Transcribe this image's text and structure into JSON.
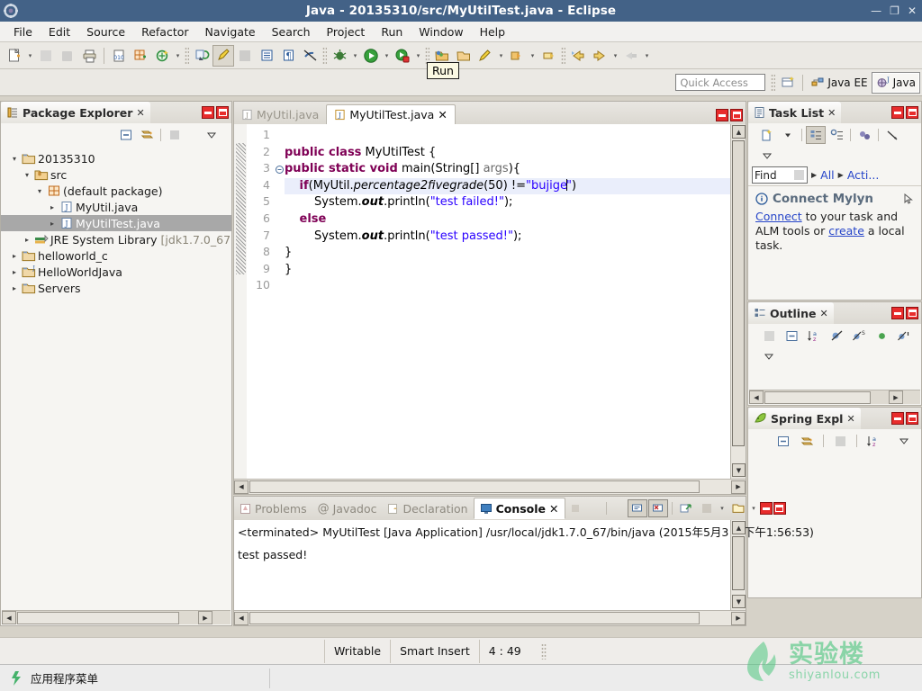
{
  "window": {
    "title": "Java - 20135310/src/MyUtilTest.java - Eclipse",
    "minimize": "—",
    "restore": "❐",
    "close": "✕",
    "app_icon": "eclipse-icon",
    "titlebar_color": "#436287"
  },
  "menu": {
    "items": [
      {
        "label": "File"
      },
      {
        "label": "Edit"
      },
      {
        "label": "Source"
      },
      {
        "label": "Refactor"
      },
      {
        "label": "Navigate"
      },
      {
        "label": "Search"
      },
      {
        "label": "Project"
      },
      {
        "label": "Run"
      },
      {
        "label": "Window"
      },
      {
        "label": "Help"
      }
    ]
  },
  "toolbar": {
    "tooltip": "Run",
    "buttons": [
      {
        "name": "new-wizard",
        "icon": "new-file-icon"
      },
      {
        "name": "save",
        "icon": "save-icon"
      },
      {
        "name": "save-all",
        "icon": "save-all-icon"
      },
      {
        "name": "print",
        "icon": "print-icon"
      },
      {
        "name": "toggle-mark-occurrences",
        "icon": "binary-icon"
      },
      {
        "name": "new-java-package",
        "icon": "package-icon"
      },
      {
        "name": "new-java-class",
        "icon": "class-icon"
      },
      {
        "name": "externalize-strings",
        "icon": "externalize-icon"
      },
      {
        "name": "open-type",
        "icon": "open-type-icon"
      },
      {
        "name": "search",
        "icon": "search-icon"
      },
      {
        "name": "toggle-block-selection",
        "icon": "block-selection-icon"
      },
      {
        "name": "show-whitespace",
        "icon": "pilcrow-icon"
      },
      {
        "name": "skip-breakpoints",
        "icon": "skip-breakpoints-icon"
      },
      {
        "name": "debug",
        "icon": "debug-bug-icon"
      },
      {
        "name": "run",
        "icon": "run-play-icon"
      },
      {
        "name": "run-external-tools",
        "icon": "external-tools-icon"
      },
      {
        "name": "open-task",
        "icon": "open-task-icon"
      },
      {
        "name": "new-folder",
        "icon": "folder-icon"
      },
      {
        "name": "new-annotation",
        "icon": "annotation-icon"
      },
      {
        "name": "previous-annotation",
        "icon": "prev-annotation-icon"
      },
      {
        "name": "next-edit-location",
        "icon": "next-edit-icon"
      },
      {
        "name": "back",
        "icon": "back-arrow-icon"
      },
      {
        "name": "forward",
        "icon": "forward-arrow-icon"
      },
      {
        "name": "pin-editor",
        "icon": "pin-icon"
      }
    ]
  },
  "perspective": {
    "quick_access_placeholder": "Quick Access",
    "open_perspective_tooltip": "Open Perspective",
    "tabs": [
      {
        "label": "Java EE",
        "active": false,
        "icon": "java-ee-perspective-icon"
      },
      {
        "label": "Java",
        "active": true,
        "icon": "java-perspective-icon"
      }
    ]
  },
  "package_explorer": {
    "title": "Package Explorer",
    "close": "✕",
    "toolbar": [
      {
        "name": "collapse-all",
        "icon": "collapse-all-icon"
      },
      {
        "name": "link-with-editor",
        "icon": "link-editor-icon"
      },
      {
        "name": "view-menu-filters",
        "icon": "filters-icon"
      },
      {
        "name": "view-menu",
        "icon": "chevron-down-icon"
      }
    ],
    "tree": [
      {
        "label": "20135310",
        "icon": "java-project-icon",
        "depth": 0,
        "twisty": "▾",
        "selected": false
      },
      {
        "label": "src",
        "icon": "source-folder-icon",
        "depth": 1,
        "twisty": "▾",
        "selected": false
      },
      {
        "label": "(default package)",
        "icon": "package-icon",
        "depth": 2,
        "twisty": "▾",
        "selected": false
      },
      {
        "label": "MyUtil.java",
        "icon": "java-file-icon",
        "depth": 3,
        "twisty": "▸",
        "selected": false
      },
      {
        "label": "MyUtilTest.java",
        "icon": "java-file-icon",
        "depth": 3,
        "twisty": "▸",
        "selected": true
      },
      {
        "label": "JRE System Library",
        "suffix": "[jdk1.7.0_67",
        "icon": "jre-library-icon",
        "depth": 2,
        "twisty": "▸",
        "selected": false
      },
      {
        "label": "helloworld_c",
        "icon": "project-folder-icon",
        "depth": 0,
        "twisty": "▸",
        "selected": false
      },
      {
        "label": "HelloWorldJava",
        "icon": "java-project-icon",
        "depth": 0,
        "twisty": "▸",
        "selected": false
      },
      {
        "label": "Servers",
        "icon": "project-folder-icon",
        "depth": 0,
        "twisty": "▸",
        "selected": false
      }
    ]
  },
  "editor": {
    "tabs": [
      {
        "label": "MyUtil.java",
        "active": false,
        "icon": "java-file-icon"
      },
      {
        "label": "MyUtilTest.java",
        "active": true,
        "icon": "java-file-icon",
        "close": "✕"
      }
    ],
    "lines": [
      "1",
      "2",
      "3",
      "4",
      "5",
      "6",
      "7",
      "8",
      "9",
      "10"
    ],
    "code": [
      {
        "n": "1",
        "text": "",
        "highlight": false
      },
      {
        "n": "2",
        "text": "public class MyUtilTest {",
        "highlight": false
      },
      {
        "n": "3",
        "text": "public static void main(String[] args){",
        "highlight": false,
        "fold": "⊖"
      },
      {
        "n": "4",
        "text": "    if(MyUtil.percentage2fivegrade(50) !=\"bujige\")",
        "highlight": true
      },
      {
        "n": "5",
        "text": "        System.out.println(\"test failed!\");",
        "highlight": false
      },
      {
        "n": "6",
        "text": "    else",
        "highlight": false
      },
      {
        "n": "7",
        "text": "        System.out.println(\"test passed!\");",
        "highlight": false
      },
      {
        "n": "8",
        "text": "}",
        "highlight": false
      },
      {
        "n": "9",
        "text": "}",
        "highlight": false
      },
      {
        "n": "10",
        "text": "",
        "highlight": false
      }
    ]
  },
  "task_list": {
    "title": "Task List",
    "close": "✕",
    "toolbar": [
      {
        "name": "new-task",
        "icon": "new-task-icon"
      },
      {
        "name": "new-task-dropdown",
        "icon": "chevron-down-icon"
      },
      {
        "name": "categorized-presentation",
        "icon": "categorized-icon"
      },
      {
        "name": "scheduled-presentation",
        "icon": "scheduled-icon"
      },
      {
        "name": "synchronize-changed",
        "icon": "synchronize-icon"
      },
      {
        "name": "focus-on-workweek",
        "icon": "focus-icon"
      },
      {
        "name": "view-menu",
        "icon": "chevron-down-icon"
      }
    ],
    "find_label": "Find",
    "find_icon": "find-icon",
    "filters": [
      "All",
      "Acti..."
    ],
    "connect_title": "Connect Mylyn",
    "connect_icon": "info-icon",
    "body_link1": "Connect",
    "body_text1": " to your task and ALM tools or ",
    "body_link2": "create",
    "body_text2": " a local task."
  },
  "outline": {
    "title": "Outline",
    "close": "✕",
    "toolbar": [
      {
        "name": "focus-on-active-task",
        "icon": "focus-icon"
      },
      {
        "name": "collapse-all",
        "icon": "collapse-all-icon"
      },
      {
        "name": "sort",
        "icon": "sort-az-icon"
      },
      {
        "name": "hide-fields",
        "icon": "hide-fields-icon"
      },
      {
        "name": "hide-static",
        "icon": "hide-static-icon"
      },
      {
        "name": "hide-non-public",
        "icon": "hide-nonpublic-icon"
      },
      {
        "name": "hide-local-types",
        "icon": "hide-local-icon"
      },
      {
        "name": "view-menu",
        "icon": "chevron-down-icon"
      }
    ]
  },
  "spring_explorer": {
    "title": "Spring Expl",
    "close": "✕",
    "icon": "spring-leaf-icon",
    "toolbar": [
      {
        "name": "collapse-all",
        "icon": "collapse-all-icon"
      },
      {
        "name": "link-with-editor",
        "icon": "link-editor-icon"
      },
      {
        "name": "filters",
        "icon": "filters-icon"
      },
      {
        "name": "sort",
        "icon": "sort-az-icon"
      },
      {
        "name": "view-menu",
        "icon": "chevron-down-icon"
      }
    ]
  },
  "bottom_panel": {
    "tabs": [
      {
        "label": "Problems",
        "active": false,
        "icon": "problems-icon"
      },
      {
        "label": "Javadoc",
        "active": false,
        "icon": "javadoc-icon"
      },
      {
        "label": "Declaration",
        "active": false,
        "icon": "declaration-icon"
      },
      {
        "label": "Console",
        "active": true,
        "icon": "console-icon",
        "close": "✕"
      }
    ],
    "toolbar": [
      {
        "name": "terminate",
        "icon": "terminate-icon"
      },
      {
        "name": "remove-launch",
        "icon": "remove-launch-icon"
      },
      {
        "name": "remove-all-terminated",
        "icon": "remove-all-icon"
      },
      {
        "name": "clear-console",
        "icon": "clear-console-icon"
      },
      {
        "name": "scroll-lock",
        "icon": "scroll-lock-icon"
      },
      {
        "name": "pin-console",
        "icon": "pin-console-icon"
      },
      {
        "name": "display-selected-console",
        "icon": "display-console-icon"
      },
      {
        "name": "open-console",
        "icon": "open-console-icon"
      }
    ],
    "console_header": "<terminated> MyUtilTest [Java Application] /usr/local/jdk1.7.0_67/bin/java (2015年5月3日 下午1:56:53)",
    "console_output": "test passed!"
  },
  "status_bar": {
    "writable": "Writable",
    "insert_mode": "Smart Insert",
    "cursor_position": "4 : 49"
  },
  "taskbar": {
    "label": "应用程序菜单",
    "icon": "apps-menu-icon"
  },
  "watermark": {
    "cn": "实验楼",
    "en": "shiyanlou.com",
    "color": "#38c172"
  }
}
